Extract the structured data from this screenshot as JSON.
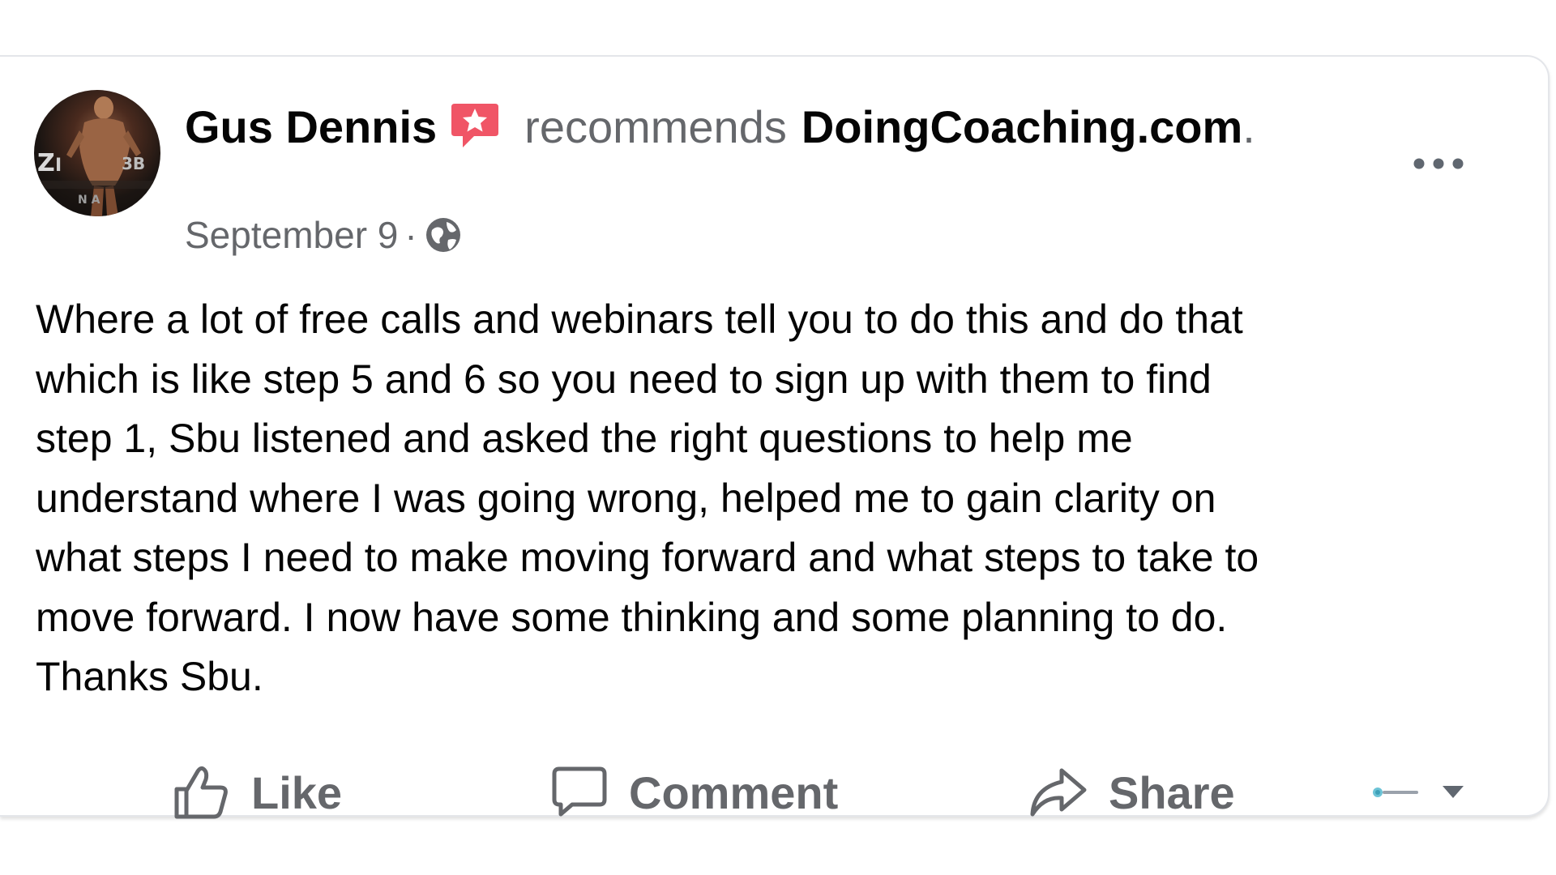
{
  "post": {
    "author_name": "Gus Dennis",
    "recommends_word": "recommends",
    "page_name": "DoingCoaching.com",
    "period": ".",
    "date": "September 9",
    "dot": "·",
    "privacy_icon": "globe-icon",
    "more_icon": "more-options-icon",
    "body_lines": [
      "Where a lot of free calls and webinars tell you to do this and do that",
      "which is like step 5 and 6 so you need to sign up with them to find",
      "step 1, Sbu listened and asked the right questions to help me",
      "understand where I was going wrong, helped me to gain clarity on",
      "what steps I need to make moving forward and what steps to take to",
      "move forward. I now have some thinking and some planning to do.",
      "Thanks Sbu."
    ]
  },
  "actions": {
    "like_label": "Like",
    "comment_label": "Comment",
    "share_label": "Share",
    "like_icon": "thumbs-up-icon",
    "comment_icon": "comment-bubble-icon",
    "share_icon": "share-arrow-icon",
    "audience_icon": "audience-selector-icon"
  },
  "colors": {
    "recommend_badge": "#f05566",
    "text_primary": "#050505",
    "text_secondary": "#65676b"
  }
}
